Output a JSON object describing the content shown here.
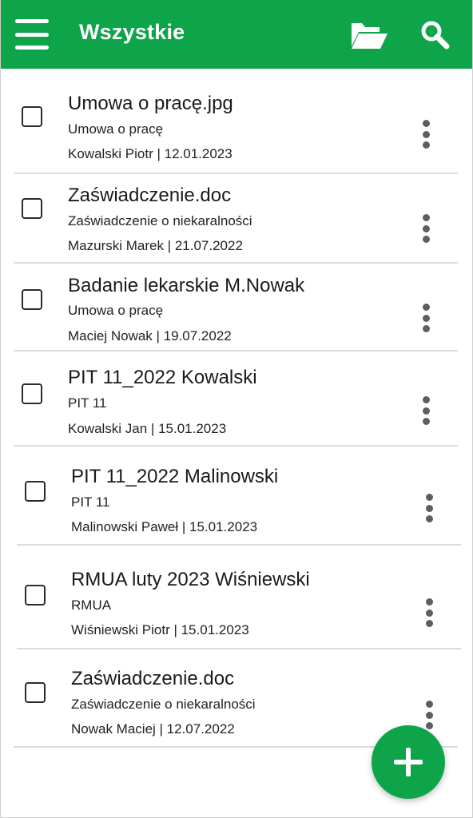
{
  "appbar": {
    "title": "Wszystkie",
    "background_color": "#0da44a",
    "menu_icon": "hamburger-menu-icon",
    "folder_icon": "open-folder-icon",
    "search_icon": "search-icon"
  },
  "documents": [
    {
      "title": "Umowa o pracę.jpg",
      "type": "Umowa o pracę",
      "meta": "Kowalski Piotr | 12.01.2023"
    },
    {
      "title": "Zaświadczenie.doc",
      "type": "Zaświadczenie o niekaralności",
      "meta": "Mazurski Marek | 21.07.2022"
    },
    {
      "title": "Badanie lekarskie M.Nowak",
      "type": "Umowa o pracę",
      "meta": "Maciej Nowak | 19.07.2022"
    },
    {
      "title": "PIT 11_2022 Kowalski",
      "type": "PIT 11",
      "meta": "Kowalski Jan | 15.01.2023"
    },
    {
      "title": "PIT 11_2022 Malinowski",
      "type": "PIT 11",
      "meta": "Malinowski Paweł | 15.01.2023"
    },
    {
      "title": "RMUA luty 2023 Wiśniewski",
      "type": "RMUA",
      "meta": "Wiśniewski Piotr | 15.01.2023"
    },
    {
      "title": "Zaświadczenie.doc",
      "type": "Zaświadczenie o niekaralności",
      "meta": "Nowak Maciej | 12.07.2022"
    }
  ],
  "fab": {
    "icon": "plus-icon",
    "color": "#0da44a"
  }
}
